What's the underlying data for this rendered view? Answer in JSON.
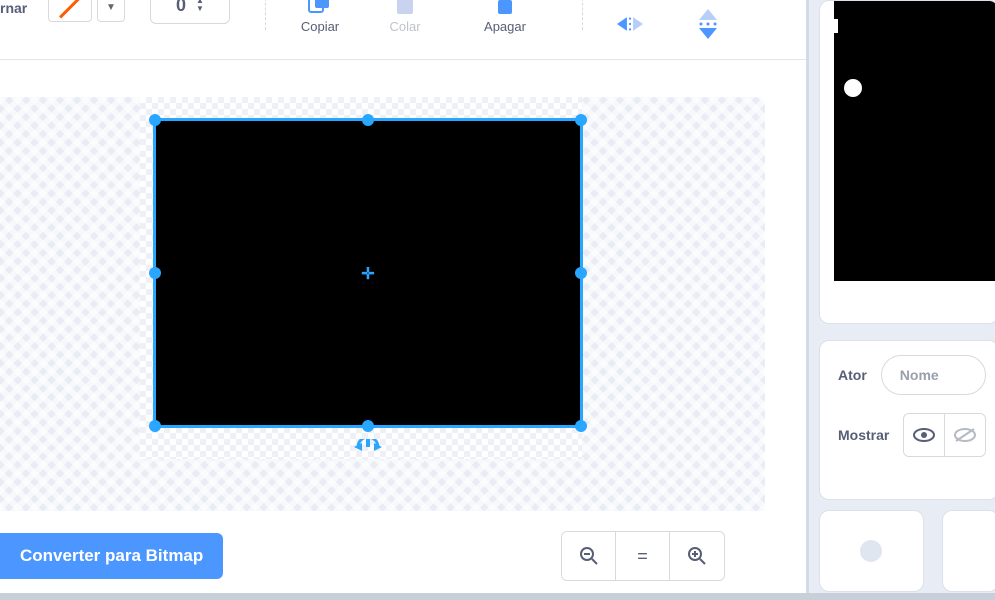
{
  "toolbar": {
    "layer_label": "rnar",
    "stroke_width": "0",
    "copy_label": "Copiar",
    "paste_label": "Colar",
    "delete_label": "Apagar"
  },
  "bottom": {
    "convert_label": "Converter para Bitmap",
    "zoom_reset_label": "="
  },
  "sprite": {
    "actor_label": "Ator",
    "name_placeholder": "Nome",
    "show_label": "Mostrar"
  },
  "colors": {
    "accent": "#4c97ff",
    "selection": "#29a6ff"
  }
}
